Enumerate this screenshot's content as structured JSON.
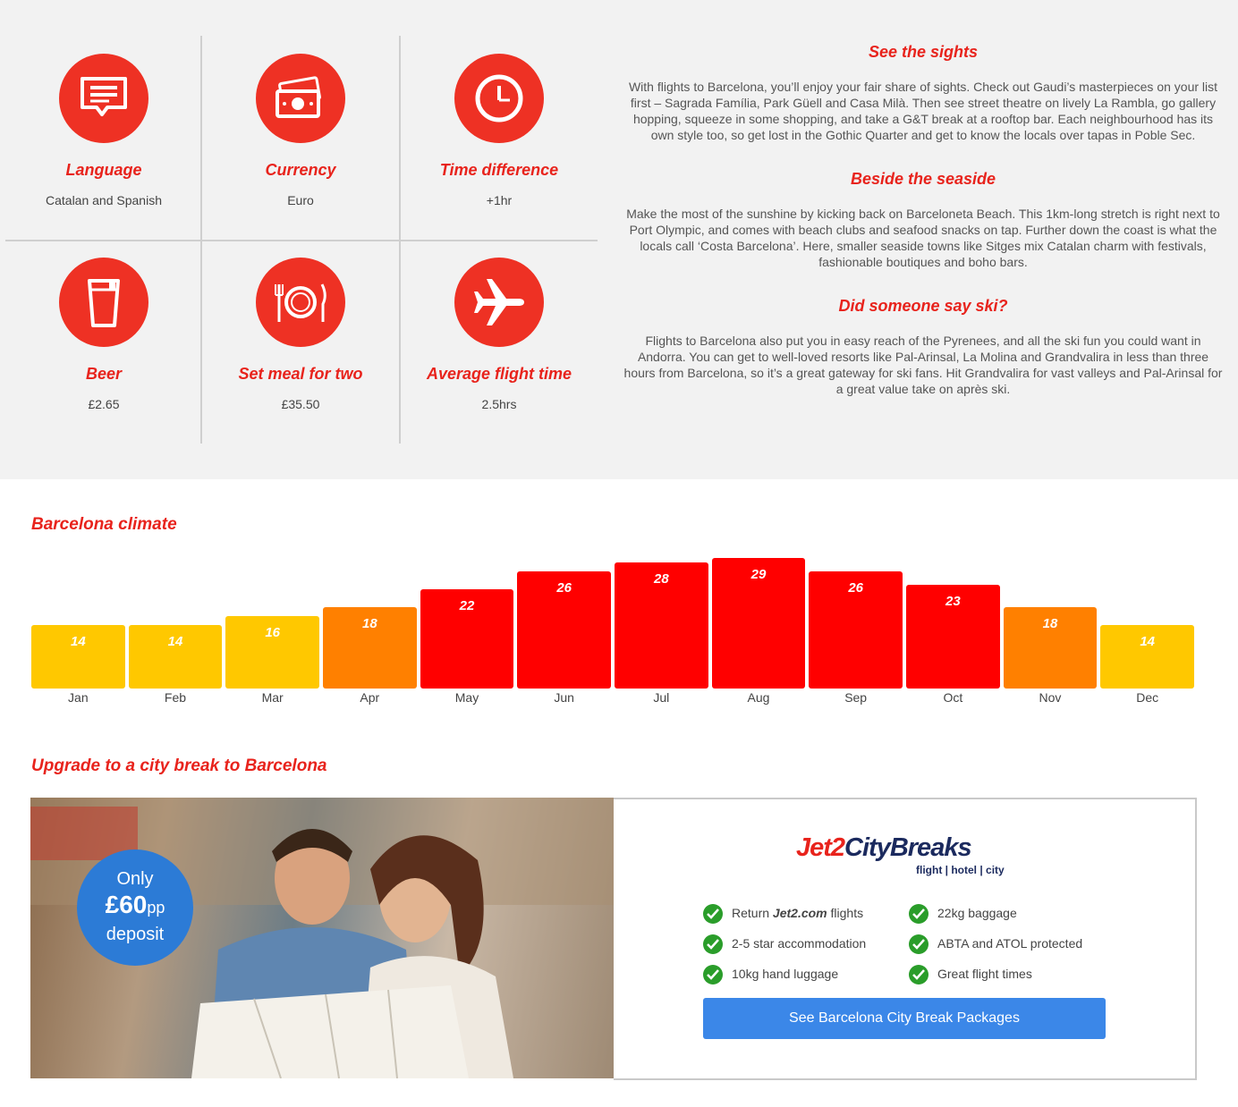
{
  "facts": [
    {
      "title": "Language",
      "value": "Catalan and Spanish",
      "icon": "speech-bubble-icon"
    },
    {
      "title": "Currency",
      "value": "Euro",
      "icon": "banknotes-icon"
    },
    {
      "title": "Time difference",
      "value": "+1hr",
      "icon": "clock-icon"
    },
    {
      "title": "Beer",
      "value": "£2.65",
      "icon": "glass-icon"
    },
    {
      "title": "Set meal for two",
      "value": "£35.50",
      "icon": "plate-cutlery-icon"
    },
    {
      "title": "Average flight time",
      "value": "2.5hrs",
      "icon": "airplane-icon"
    }
  ],
  "info": [
    {
      "heading": "See the sights",
      "text": "With flights to Barcelona, you’ll enjoy your fair share of sights. Check out Gaudi’s masterpieces on your list first – Sagrada Família, Park Güell and Casa Milà. Then see street theatre on lively La Rambla, go gallery hopping, squeeze in some shopping, and take a G&T break at a rooftop bar. Each neighbourhood has its own style too, so get lost in the Gothic Quarter and get to know the locals over tapas in Poble Sec."
    },
    {
      "heading": "Beside the seaside",
      "text": "Make the most of the sunshine by kicking back on Barceloneta Beach. This 1km-long stretch is right next to Port Olympic, and comes with beach clubs and seafood snacks on tap. Further down the coast is what the locals call ‘Costa Barcelona’. Here, smaller seaside towns like Sitges mix Catalan charm with festivals, fashionable boutiques and boho bars."
    },
    {
      "heading": "Did someone say ski?",
      "text": "Flights to Barcelona also put you in easy reach of the Pyrenees, and all the ski fun you could want in Andorra. You can get to well-loved resorts like Pal-Arinsal, La Molina and Grandvalira in less than three hours from Barcelona, so it’s a great gateway for ski fans. Hit Grandvalira for vast valleys and Pal-Arinsal for a great value take on après ski."
    }
  ],
  "climate_title": "Barcelona climate",
  "chart_data": {
    "type": "bar",
    "title": "Barcelona climate",
    "categories": [
      "Jan",
      "Feb",
      "Mar",
      "Apr",
      "May",
      "Jun",
      "Jul",
      "Aug",
      "Sep",
      "Oct",
      "Nov",
      "Dec"
    ],
    "values": [
      14,
      14,
      16,
      18,
      22,
      26,
      28,
      29,
      26,
      23,
      18,
      14
    ],
    "colors": {
      "cool": "#ffc800",
      "mild": "#ff8000",
      "hot": "#ff0000"
    },
    "xlabel": "",
    "ylabel": "",
    "grid": false
  },
  "upgrade_title": "Upgrade to a city break to Barcelona",
  "deposit": {
    "line1": "Only",
    "amount": "£60",
    "unit": "pp",
    "line3": "deposit"
  },
  "logo": {
    "jet": "Jet2",
    "city": "CityBreaks",
    "tagline": "flight | hotel | city"
  },
  "features": [
    {
      "pre": "Return ",
      "brand": "Jet2.com",
      "post": " flights"
    },
    {
      "text": "22kg baggage"
    },
    {
      "text": "2-5 star accommodation"
    },
    {
      "text": "ABTA and ATOL protected"
    },
    {
      "text": "10kg hand luggage"
    },
    {
      "text": "Great flight times"
    }
  ],
  "cta_label": "See Barcelona City Break Packages"
}
